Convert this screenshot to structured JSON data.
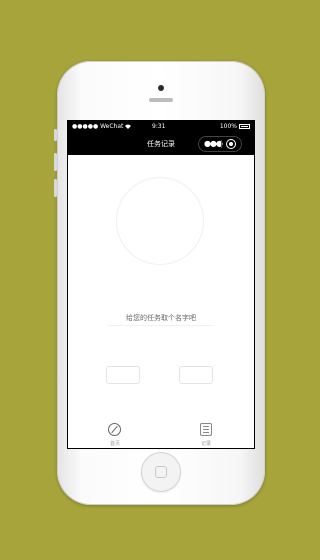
{
  "status_bar": {
    "carrier": "●●●●● WeChat",
    "wifi": "wifi-icon",
    "time": "9:31",
    "battery": "100%"
  },
  "nav": {
    "title": "任务记录",
    "more_icon": "more-dots-icon",
    "close_icon": "target-icon"
  },
  "main": {
    "input_placeholder": "给您的任务取个名字吧",
    "input_value": ""
  },
  "tabbar": {
    "items": [
      {
        "label": "首页",
        "icon": "compass-icon"
      },
      {
        "label": "记录",
        "icon": "list-icon"
      }
    ]
  },
  "colors": {
    "background": "#a6a43a",
    "navbar": "#000000"
  }
}
